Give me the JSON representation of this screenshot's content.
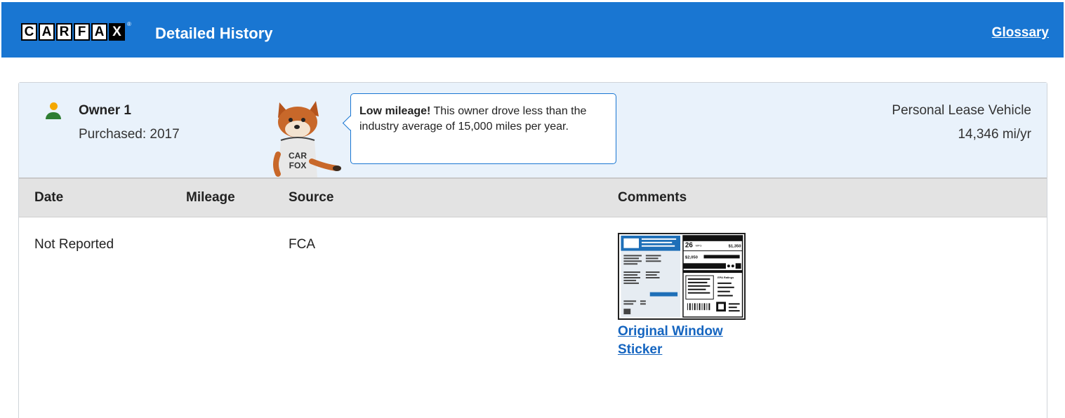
{
  "header": {
    "logo_letters": [
      "C",
      "A",
      "R",
      "F",
      "A",
      "X"
    ],
    "title": "Detailed History",
    "glossary_link": "Glossary",
    "brand_color": "#1976d2"
  },
  "owner": {
    "name": "Owner 1",
    "purchased": "Purchased: 2017",
    "usage_type": "Personal Lease Vehicle",
    "miles_per_year": "14,346 mi/yr",
    "bubble_bold": "Low mileage!",
    "bubble_text": " This owner drove less than the industry average of 15,000 miles per year.",
    "fox_shirt_text": "CAR FOX"
  },
  "table": {
    "columns": [
      "Date",
      "Mileage",
      "Source",
      "Comments"
    ],
    "rows": [
      {
        "date": "Not Reported",
        "mileage": "",
        "source": "FCA",
        "comment_link": "Original Window Sticker"
      }
    ]
  },
  "sticker": {
    "mpg": "26",
    "mpg_unit": "MPG",
    "cost_top": "$1,350",
    "cost_left": "$2,050",
    "ratings_label": "EPA Ratings"
  }
}
